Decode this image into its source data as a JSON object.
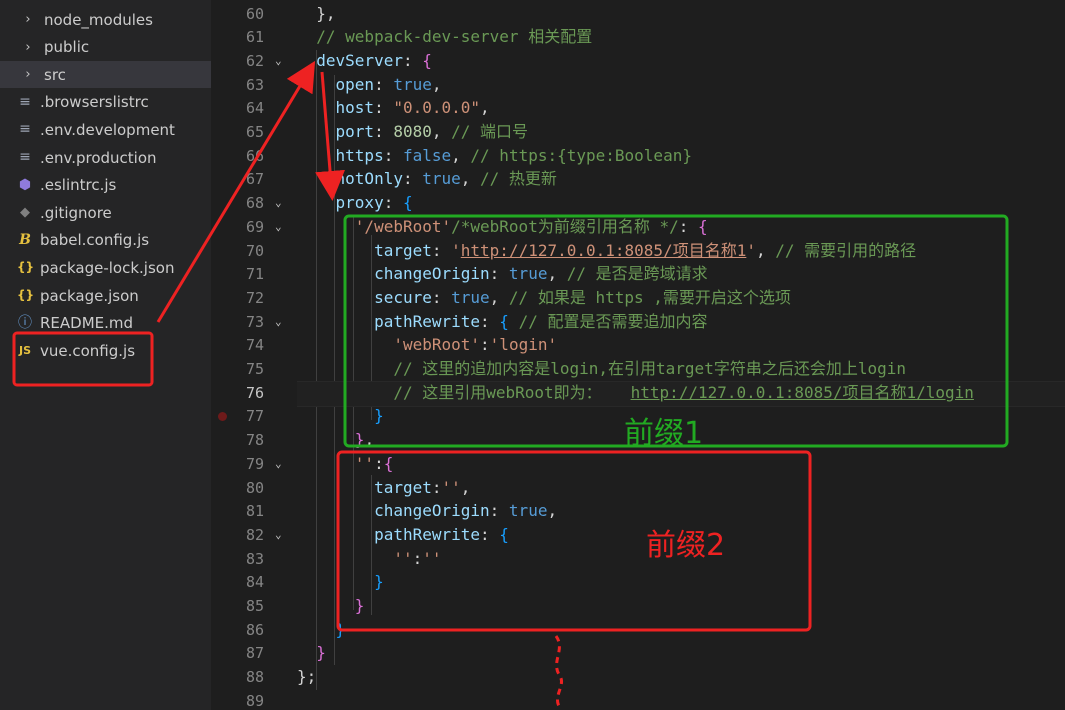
{
  "explorer": {
    "items": [
      {
        "name": "node_modules",
        "icon": "chevron-right-icon",
        "glyph": "›",
        "type": "folder"
      },
      {
        "name": "public",
        "icon": "chevron-right-icon",
        "glyph": "›",
        "type": "folder"
      },
      {
        "name": "src",
        "icon": "chevron-right-icon",
        "glyph": "›",
        "type": "folder",
        "active": true
      },
      {
        "name": ".browserslistrc",
        "icon": "lines-file-icon",
        "glyph": "≡",
        "type": "file"
      },
      {
        "name": ".env.development",
        "icon": "lines-file-icon",
        "glyph": "≡",
        "type": "file"
      },
      {
        "name": ".env.production",
        "icon": "lines-file-icon",
        "glyph": "≡",
        "type": "file"
      },
      {
        "name": ".eslintrc.js",
        "icon": "eslint-icon",
        "glyph": "⬢",
        "type": "file"
      },
      {
        "name": ".gitignore",
        "icon": "git-icon",
        "glyph": "◆",
        "type": "file"
      },
      {
        "name": "babel.config.js",
        "icon": "babel-icon",
        "glyph": "B",
        "type": "file"
      },
      {
        "name": "package-lock.json",
        "icon": "json-icon",
        "glyph": "{}",
        "type": "file"
      },
      {
        "name": "package.json",
        "icon": "json-icon",
        "glyph": "{}",
        "type": "file"
      },
      {
        "name": "README.md",
        "icon": "info-icon",
        "glyph": "ⓘ",
        "type": "file"
      },
      {
        "name": "vue.config.js",
        "icon": "js-file-icon",
        "glyph": "JS",
        "type": "file"
      }
    ]
  },
  "editor": {
    "line_numbers": [
      "60",
      "61",
      "62",
      "63",
      "64",
      "65",
      "66",
      "67",
      "68",
      "69",
      "70",
      "71",
      "72",
      "73",
      "74",
      "75",
      "76",
      "77",
      "78",
      "79",
      "80",
      "81",
      "82",
      "83",
      "84",
      "85",
      "86",
      "87",
      "88",
      "89"
    ],
    "current_line": "76",
    "lines": [
      {
        "no": "60",
        "tokens": [
          [
            "t-punc",
            "  },"
          ]
        ]
      },
      {
        "no": "61",
        "tokens": [
          [
            "t-com",
            "  // webpack-dev-server 相关配置"
          ]
        ]
      },
      {
        "no": "62",
        "tokens": [
          [
            "t-prop",
            "  devServer"
          ],
          [
            "t-punc",
            ": "
          ],
          [
            "t-bracket",
            "{"
          ]
        ]
      },
      {
        "no": "63",
        "tokens": [
          [
            "t-prop",
            "    open"
          ],
          [
            "t-punc",
            ": "
          ],
          [
            "t-bool",
            "true"
          ],
          [
            "t-punc",
            ","
          ]
        ]
      },
      {
        "no": "64",
        "tokens": [
          [
            "t-prop",
            "    host"
          ],
          [
            "t-punc",
            ": "
          ],
          [
            "t-str",
            "\"0.0.0.0\""
          ],
          [
            "t-punc",
            ","
          ]
        ]
      },
      {
        "no": "65",
        "tokens": [
          [
            "t-prop",
            "    port"
          ],
          [
            "t-punc",
            ": "
          ],
          [
            "t-num",
            "8080"
          ],
          [
            "t-punc",
            ", "
          ],
          [
            "t-com",
            "// 端口号"
          ]
        ]
      },
      {
        "no": "66",
        "tokens": [
          [
            "t-prop",
            "    https"
          ],
          [
            "t-punc",
            ": "
          ],
          [
            "t-bool",
            "false"
          ],
          [
            "t-punc",
            ", "
          ],
          [
            "t-com",
            "// https:{type:Boolean}"
          ]
        ]
      },
      {
        "no": "67",
        "tokens": [
          [
            "t-prop",
            "    hotOnly"
          ],
          [
            "t-punc",
            ": "
          ],
          [
            "t-bool",
            "true"
          ],
          [
            "t-punc",
            ", "
          ],
          [
            "t-com",
            "// 热更新"
          ]
        ]
      },
      {
        "no": "68",
        "tokens": [
          [
            "t-prop",
            "    proxy"
          ],
          [
            "t-punc",
            ": "
          ],
          [
            "t-brk2",
            "{"
          ]
        ]
      },
      {
        "no": "69",
        "tokens": [
          [
            "t-str",
            "      '/webRoot'"
          ],
          [
            "t-com",
            "/*webRoot为前缀引用名称 */"
          ],
          [
            "t-punc",
            ": "
          ],
          [
            "t-bracket",
            "{"
          ]
        ]
      },
      {
        "no": "70",
        "tokens": [
          [
            "t-prop",
            "        target"
          ],
          [
            "t-punc",
            ": "
          ],
          [
            "t-str",
            "'"
          ],
          [
            "t-url",
            "http://127.0.0.1:8085/项目名称1"
          ],
          [
            "t-str",
            "'"
          ],
          [
            "t-punc",
            ", "
          ],
          [
            "t-com",
            "// 需要引用的路径"
          ]
        ]
      },
      {
        "no": "71",
        "tokens": [
          [
            "t-prop",
            "        changeOrigin"
          ],
          [
            "t-punc",
            ": "
          ],
          [
            "t-bool",
            "true"
          ],
          [
            "t-punc",
            ", "
          ],
          [
            "t-com",
            "// 是否是跨域请求"
          ]
        ]
      },
      {
        "no": "72",
        "tokens": [
          [
            "t-prop",
            "        secure"
          ],
          [
            "t-punc",
            ": "
          ],
          [
            "t-bool",
            "true"
          ],
          [
            "t-punc",
            ", "
          ],
          [
            "t-com",
            "// 如果是 https ,需要开启这个选项"
          ]
        ]
      },
      {
        "no": "73",
        "tokens": [
          [
            "t-prop",
            "        pathRewrite"
          ],
          [
            "t-punc",
            ": "
          ],
          [
            "t-brk2",
            "{"
          ],
          [
            "t-punc",
            " "
          ],
          [
            "t-com",
            "// 配置是否需要追加内容"
          ]
        ]
      },
      {
        "no": "74",
        "tokens": [
          [
            "t-str",
            "          'webRoot'"
          ],
          [
            "t-punc",
            ":"
          ],
          [
            "t-str",
            "'login'"
          ]
        ]
      },
      {
        "no": "75",
        "tokens": [
          [
            "t-com",
            "          // 这里的追加内容是login,在引用target字符串之后还会加上login"
          ]
        ]
      },
      {
        "no": "76",
        "tokens": [
          [
            "t-com",
            "          // 这里引用webRoot即为：   "
          ],
          [
            "t-urlc",
            "http://127.0.0.1:8085/项目名称1/login"
          ]
        ]
      },
      {
        "no": "77",
        "tokens": [
          [
            "t-brk2",
            "        }"
          ]
        ]
      },
      {
        "no": "78",
        "tokens": [
          [
            "t-bracket",
            "      }"
          ],
          [
            "t-punc",
            ","
          ]
        ]
      },
      {
        "no": "79",
        "tokens": [
          [
            "t-str",
            "      ''"
          ],
          [
            "t-punc",
            ":"
          ],
          [
            "t-bracket",
            "{"
          ]
        ]
      },
      {
        "no": "80",
        "tokens": [
          [
            "t-prop",
            "        target"
          ],
          [
            "t-punc",
            ":"
          ],
          [
            "t-str",
            "''"
          ],
          [
            "t-punc",
            ","
          ]
        ]
      },
      {
        "no": "81",
        "tokens": [
          [
            "t-prop",
            "        changeOrigin"
          ],
          [
            "t-punc",
            ": "
          ],
          [
            "t-bool",
            "true"
          ],
          [
            "t-punc",
            ","
          ]
        ]
      },
      {
        "no": "82",
        "tokens": [
          [
            "t-prop",
            "        pathRewrite"
          ],
          [
            "t-punc",
            ": "
          ],
          [
            "t-brk2",
            "{"
          ]
        ]
      },
      {
        "no": "83",
        "tokens": [
          [
            "t-str",
            "          ''"
          ],
          [
            "t-punc",
            ":"
          ],
          [
            "t-str",
            "''"
          ]
        ]
      },
      {
        "no": "84",
        "tokens": [
          [
            "t-brk2",
            "        }"
          ]
        ]
      },
      {
        "no": "85",
        "tokens": [
          [
            "t-bracket",
            "      }"
          ]
        ]
      },
      {
        "no": "86",
        "tokens": [
          [
            "t-brk2",
            "    }"
          ]
        ]
      },
      {
        "no": "87",
        "tokens": [
          [
            "t-bracket",
            "  }"
          ]
        ]
      },
      {
        "no": "88",
        "tokens": [
          [
            "t-punc",
            "};"
          ]
        ]
      },
      {
        "no": "89",
        "tokens": [
          [
            "t-punc",
            ""
          ]
        ]
      }
    ],
    "fold_lines": [
      "62",
      "68",
      "69",
      "73",
      "79",
      "82"
    ],
    "breakpoint_line": "77"
  },
  "annotations": {
    "prefix1_label": "前缀1",
    "prefix2_label": "前缀2",
    "green": "#22aa22",
    "red": "#ee2222"
  }
}
